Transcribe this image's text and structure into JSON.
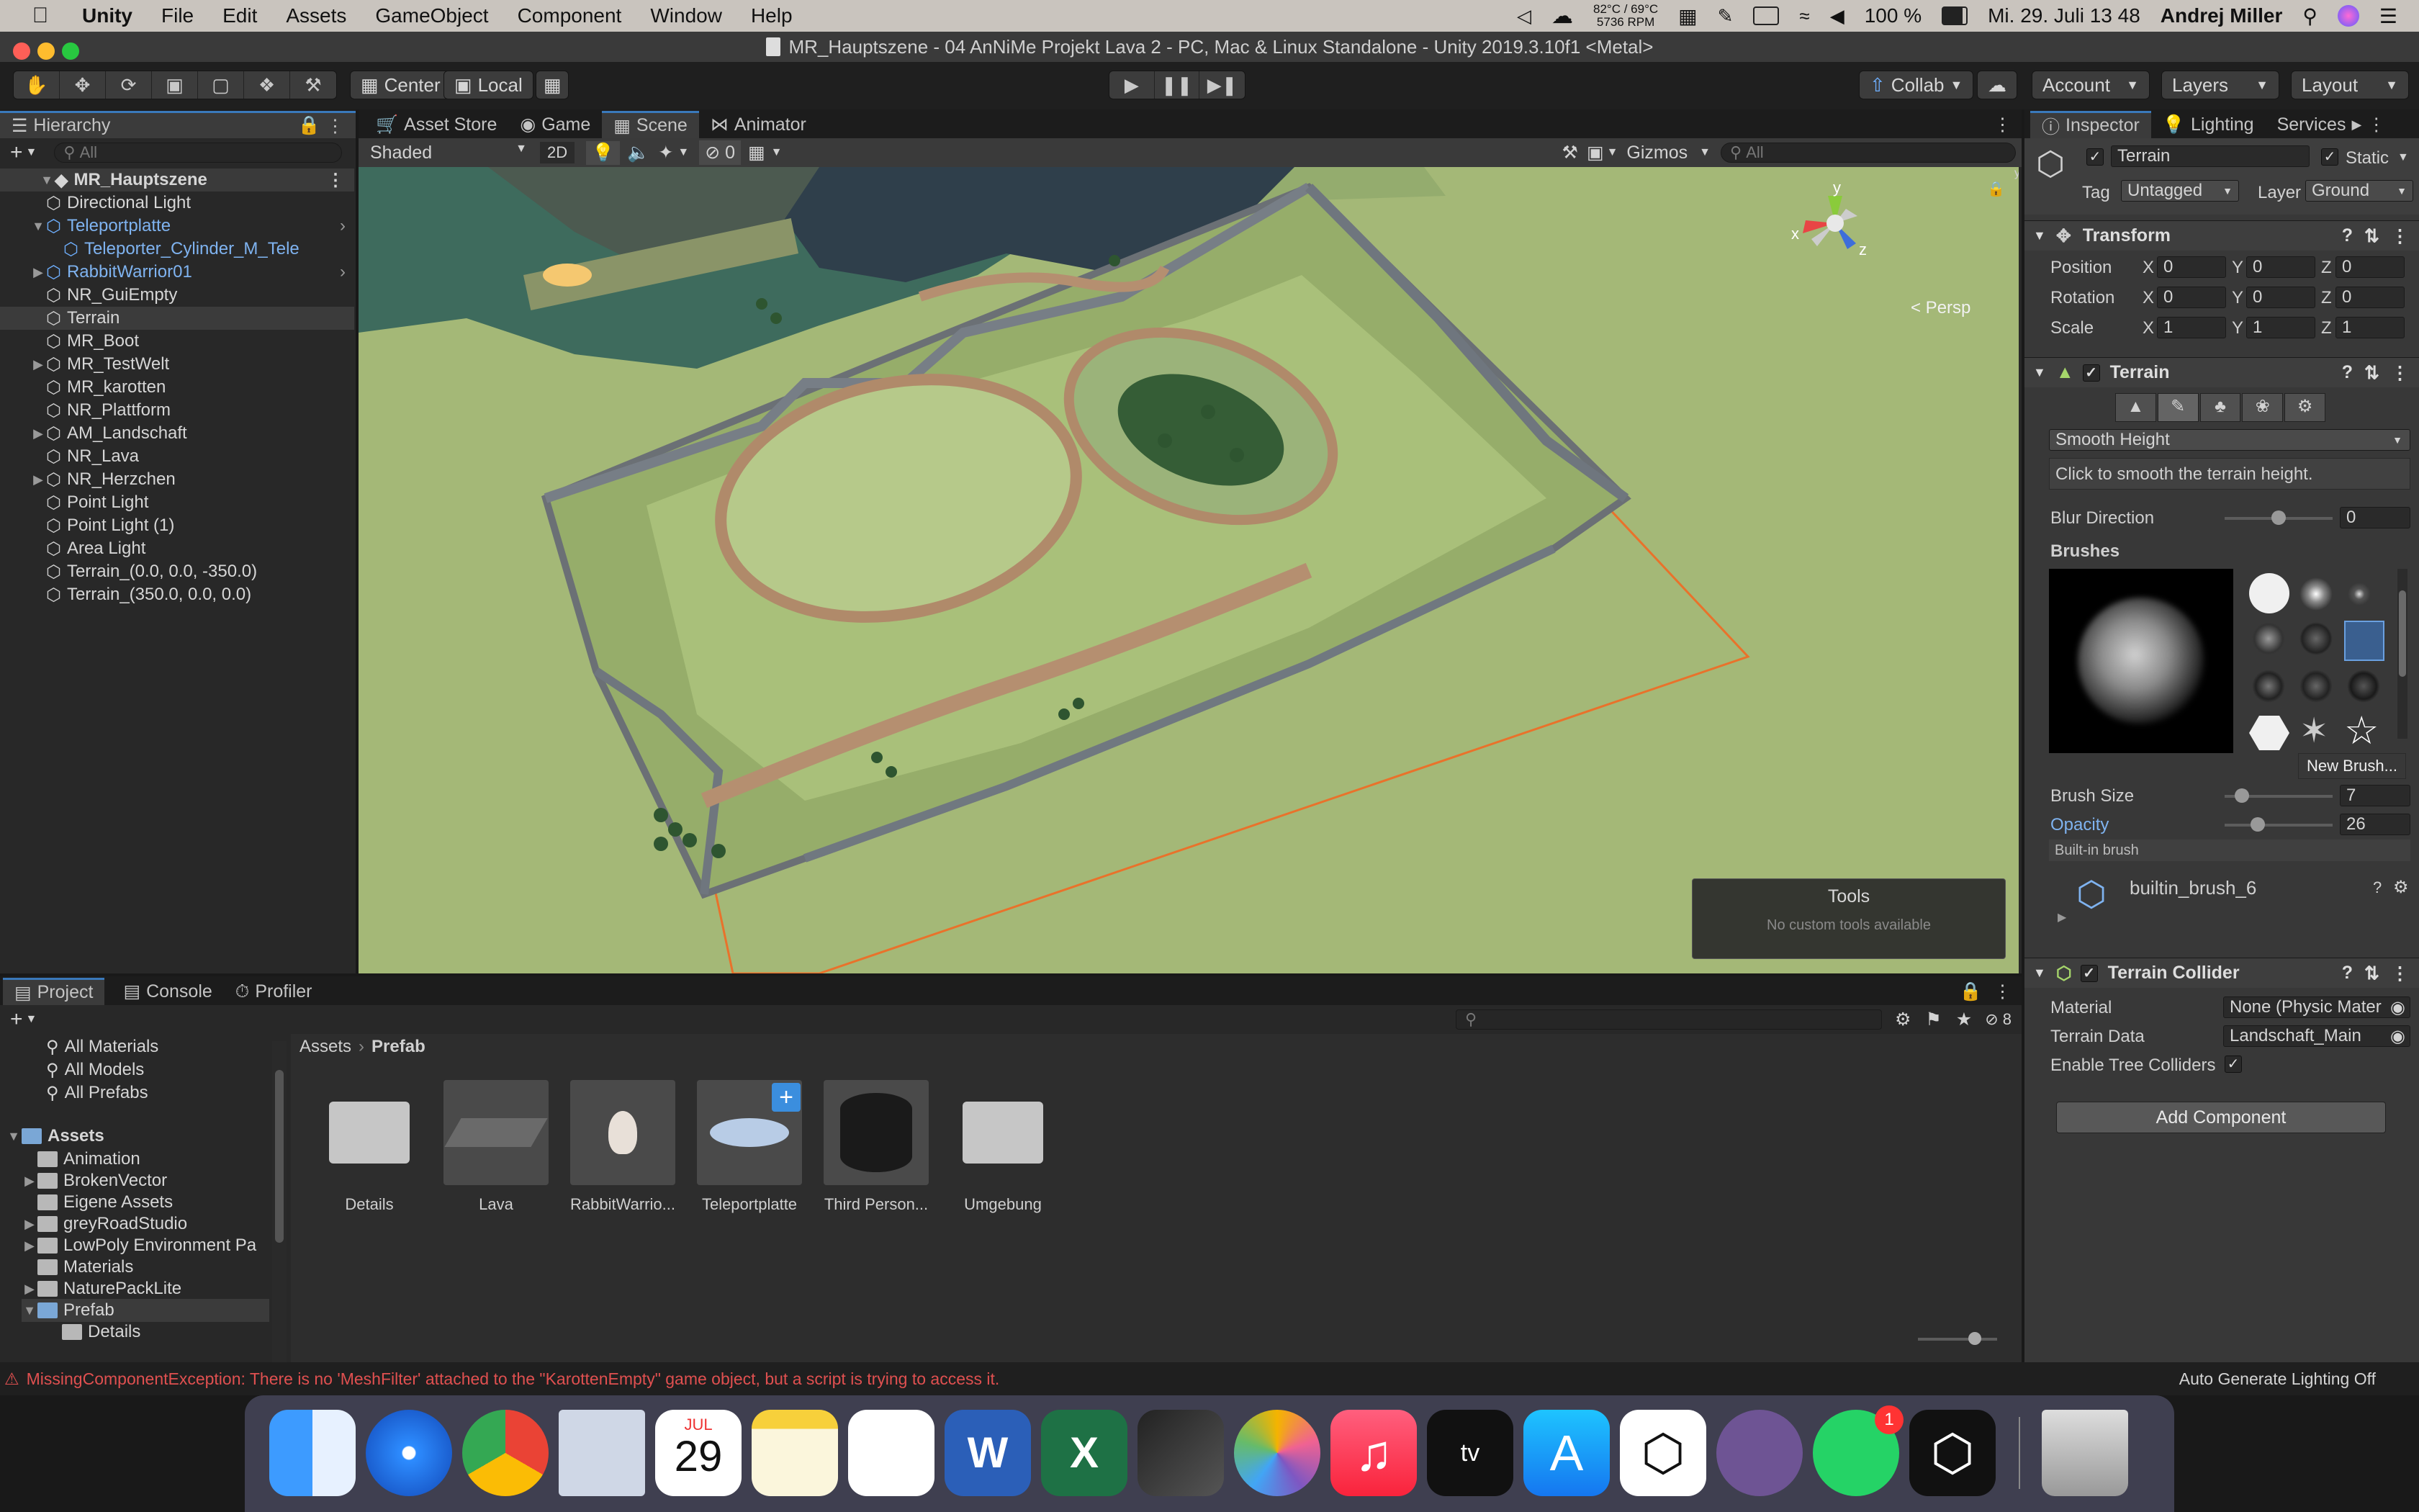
{
  "menubar": {
    "app": "Unity",
    "menus": [
      "File",
      "Edit",
      "Assets",
      "GameObject",
      "Component",
      "Window",
      "Help"
    ],
    "temp": "82°C / 69°C",
    "rpm": "5736 RPM",
    "battery": "100 %",
    "clock": "Mi. 29. Juli  13 48",
    "user": "Andrej Miller"
  },
  "window": {
    "title": "MR_Hauptszene - 04 AnNiMe Projekt Lava 2 - PC, Mac & Linux Standalone - Unity 2019.3.10f1 <Metal>"
  },
  "toolbar": {
    "center": "Center",
    "local": "Local",
    "collab": "Collab",
    "account": "Account",
    "layers": "Layers",
    "layout": "Layout"
  },
  "hierarchy": {
    "tab": "Hierarchy",
    "search_placeholder": "All",
    "scene_name": "MR_Hauptszene",
    "items": [
      {
        "label": "Directional Light"
      },
      {
        "label": "Teleportplatte"
      },
      {
        "label": "Teleporter_Cylinder_M_Tele"
      },
      {
        "label": "RabbitWarrior01"
      },
      {
        "label": "NR_GuiEmpty"
      },
      {
        "label": "Terrain"
      },
      {
        "label": "MR_Boot"
      },
      {
        "label": "MR_TestWelt"
      },
      {
        "label": "MR_karotten"
      },
      {
        "label": "NR_Plattform"
      },
      {
        "label": "AM_Landschaft"
      },
      {
        "label": "NR_Lava"
      },
      {
        "label": "NR_Herzchen"
      },
      {
        "label": "Point Light"
      },
      {
        "label": "Point Light (1)"
      },
      {
        "label": "Area Light"
      },
      {
        "label": "Terrain_(0.0, 0.0, -350.0)"
      },
      {
        "label": "Terrain_(350.0, 0.0, 0.0)"
      }
    ]
  },
  "scene_tabs": {
    "asset_store": "Asset Store",
    "game": "Game",
    "scene": "Scene",
    "animator": "Animator"
  },
  "scene_bar": {
    "shading": "Shaded",
    "mode2d": "2D",
    "hidden_count": "0",
    "gizmos": "Gizmos",
    "search_placeholder": "All"
  },
  "scene_view": {
    "persp": "< Persp",
    "axis_x": "x",
    "axis_y": "y",
    "axis_z": "z",
    "tools_title": "Tools",
    "tools_sub": "No custom tools available"
  },
  "inspector": {
    "tabs": {
      "inspector": "Inspector",
      "lighting": "Lighting",
      "services": "Services"
    },
    "object_name": "Terrain",
    "static_label": "Static",
    "tag_label": "Tag",
    "tag_value": "Untagged",
    "layer_label": "Layer",
    "layer_value": "Ground",
    "transform": {
      "title": "Transform",
      "position": "Position",
      "rotation": "Rotation",
      "scale": "Scale",
      "x": "X",
      "y": "Y",
      "z": "Z",
      "pos": [
        "0",
        "0",
        "0"
      ],
      "rot": [
        "0",
        "0",
        "0"
      ],
      "scl": [
        "1",
        "1",
        "1"
      ]
    },
    "terrain": {
      "title": "Terrain",
      "tool": "Smooth Height",
      "help": "Click to smooth the terrain height.",
      "blur_label": "Blur Direction",
      "blur_value": "0",
      "blur_fraction": 0.5,
      "brushes_label": "Brushes",
      "new_brush": "New Brush...",
      "brush_size_label": "Brush Size",
      "brush_size_value": "7",
      "opacity_label": "Opacity",
      "opacity_value": "26",
      "builtin_label": "Built-in brush",
      "brush_name": "builtin_brush_6"
    },
    "collider": {
      "title": "Terrain Collider",
      "material_label": "Material",
      "material_value": "None (Physic Mater",
      "data_label": "Terrain Data",
      "data_value": "Landschaft_Main",
      "trees_label": "Enable Tree Colliders"
    },
    "add_component": "Add Component"
  },
  "project": {
    "tabs": {
      "project": "Project",
      "console": "Console",
      "profiler": "Profiler"
    },
    "favorites": [
      "All Materials",
      "All Models",
      "All Prefabs"
    ],
    "assets_root": "Assets",
    "folders": [
      "Animation",
      "BrokenVector",
      "Eigene Assets",
      "greyRoadStudio",
      "LowPoly Environment Pa",
      "Materials",
      "NaturePackLite",
      "Prefab",
      "Details"
    ],
    "breadcrumb_root": "Assets",
    "breadcrumb_current": "Prefab",
    "hidden_count": "8",
    "items": [
      {
        "label": "Details"
      },
      {
        "label": "Lava"
      },
      {
        "label": "RabbitWarrio..."
      },
      {
        "label": "Teleportplatte"
      },
      {
        "label": "Third Person..."
      },
      {
        "label": "Umgebung"
      }
    ]
  },
  "status": {
    "error": "MissingComponentException: There is no 'MeshFilter' attached to the \"KarottenEmpty\" game object, but a script is trying to access it.",
    "lighting": "Auto Generate Lighting Off"
  },
  "dock": {
    "calendar_month": "JUL",
    "calendar_day": "29",
    "whatsapp_badge": "1",
    "apps": [
      "finder",
      "safari",
      "chrome",
      "preview",
      "calendar",
      "notes",
      "reminders",
      "word",
      "excel",
      "final-cut",
      "photos",
      "music",
      "apple-tv",
      "app-store",
      "unity",
      "github",
      "whatsapp",
      "unity-hub",
      "trash"
    ]
  },
  "colors": {
    "accent": "#3a79bb",
    "terrain": "#a9c07a",
    "error": "#e05050",
    "link_blue": "#7fb3f0"
  }
}
